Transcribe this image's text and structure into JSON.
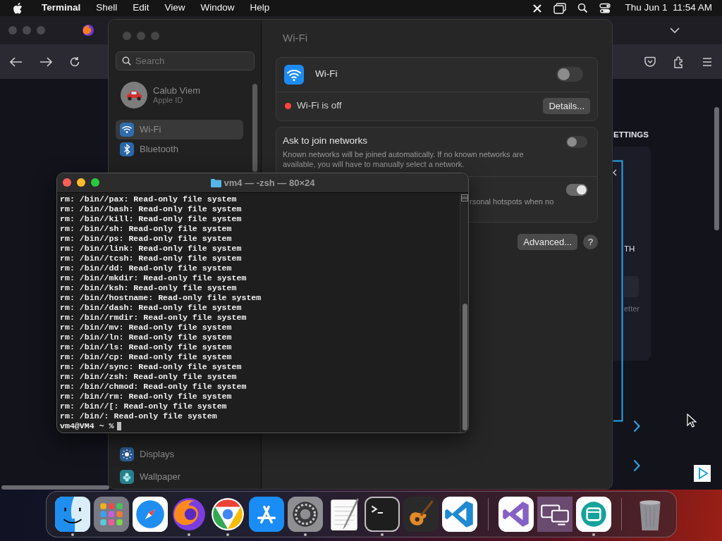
{
  "menu_bar": {
    "app_name": "Terminal",
    "menus": [
      "Shell",
      "Edit",
      "View",
      "Window",
      "Help"
    ],
    "clock": "Thu Jun 1  11:54 AM"
  },
  "browser": {
    "page": {
      "heading": "ETTINGS",
      "label": "TH",
      "hint": "etter"
    }
  },
  "settings": {
    "title": "Wi-Fi",
    "search": {
      "placeholder": "Search"
    },
    "account": {
      "name": "Calub Viem",
      "subtitle": "Apple ID"
    },
    "sidebar": {
      "items": [
        {
          "label": "Wi-Fi",
          "kind": "wifi",
          "selected": true
        },
        {
          "label": "Bluetooth",
          "kind": "bluetooth",
          "selected": false
        }
      ],
      "lower_items": [
        {
          "label": "Displays",
          "kind": "displays",
          "selected": false
        },
        {
          "label": "Wallpaper",
          "kind": "wallpaper",
          "selected": false
        }
      ]
    },
    "wifi_card": {
      "label": "Wi-Fi",
      "on": false,
      "status": "Wi-Fi is off",
      "details_button": "Details..."
    },
    "ask_to_join": {
      "label": "Ask to join networks",
      "description": "Known networks will be joined automatically. If no known networks are available, you will have to manually select a network.",
      "on": false
    },
    "hotspot_row": {
      "description": "rsonal hotspots when no",
      "on": true
    },
    "advanced_button": "Advanced...",
    "help_button": "?"
  },
  "terminal": {
    "title": "vm4 — -zsh — 80×24",
    "lines": [
      "rm: /bin//pax: Read-only file system",
      "rm: /bin//bash: Read-only file system",
      "rm: /bin//kill: Read-only file system",
      "rm: /bin//sh: Read-only file system",
      "rm: /bin//ps: Read-only file system",
      "rm: /bin//link: Read-only file system",
      "rm: /bin//tcsh: Read-only file system",
      "rm: /bin//dd: Read-only file system",
      "rm: /bin//mkdir: Read-only file system",
      "rm: /bin//ksh: Read-only file system",
      "rm: /bin//hostname: Read-only file system",
      "rm: /bin//dash: Read-only file system",
      "rm: /bin//rmdir: Read-only file system",
      "rm: /bin//mv: Read-only file system",
      "rm: /bin//ln: Read-only file system",
      "rm: /bin//ls: Read-only file system",
      "rm: /bin//cp: Read-only file system",
      "rm: /bin//sync: Read-only file system",
      "rm: /bin//zsh: Read-only file system",
      "rm: /bin//chmod: Read-only file system",
      "rm: /bin//rm: Read-only file system",
      "rm: /bin//[: Read-only file system",
      "rm: /bin/: Read-only file system"
    ],
    "prompt": "vm4@VM4 ~ %"
  },
  "dock": {
    "items": [
      {
        "kind": "finder",
        "running": true
      },
      {
        "kind": "launchpad",
        "running": false
      },
      {
        "kind": "safari",
        "running": false
      },
      {
        "kind": "firefox",
        "running": true
      },
      {
        "kind": "chrome",
        "running": true
      },
      {
        "kind": "appstore",
        "running": false
      },
      {
        "kind": "settings",
        "running": true
      },
      {
        "kind": "textedit",
        "running": false
      },
      {
        "kind": "terminal",
        "running": true
      },
      {
        "kind": "guitar",
        "running": false
      },
      {
        "kind": "vscode",
        "running": false
      },
      {
        "kind": "divider"
      },
      {
        "kind": "studio",
        "running": false
      },
      {
        "kind": "remote",
        "running": false
      },
      {
        "kind": "circleapp",
        "running": true
      },
      {
        "kind": "divider"
      },
      {
        "kind": "trash",
        "running": false
      }
    ]
  }
}
